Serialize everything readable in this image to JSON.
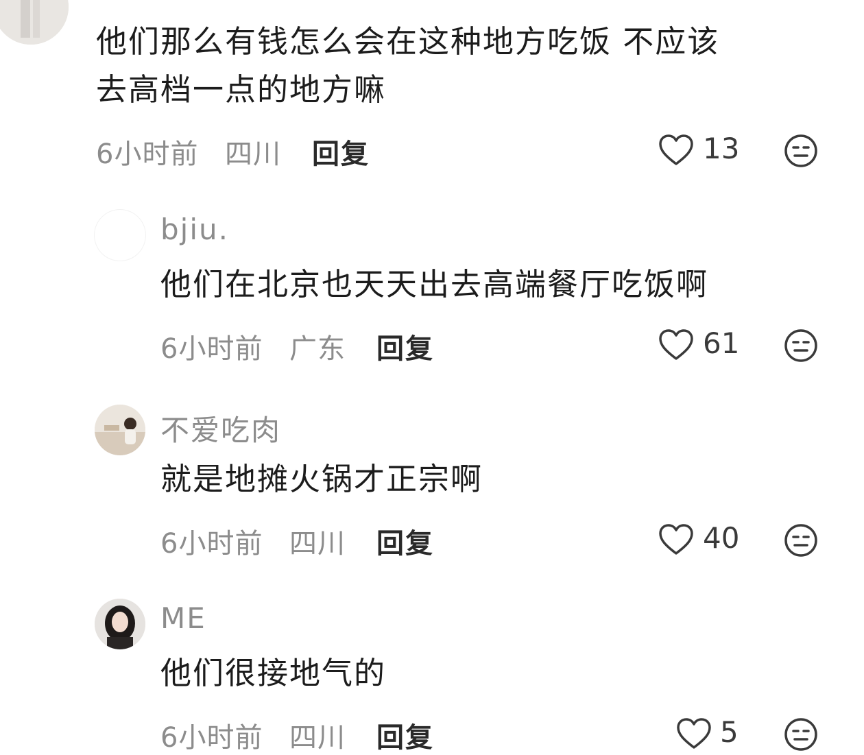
{
  "comments": [
    {
      "text_line1": "他们那么有钱怎么会在这种地方吃饭  不应该",
      "text_line2": "去高档一点的地方嘛",
      "time": "6小时前",
      "location": "四川",
      "reply_label": "回复",
      "likes": "13"
    },
    {
      "username": "bjiu.",
      "text": "他们在北京也天天出去高端餐厅吃饭啊",
      "time": "6小时前",
      "location": "广东",
      "reply_label": "回复",
      "likes": "61"
    },
    {
      "username": "不爱吃肉",
      "text": "就是地摊火锅才正宗啊",
      "time": "6小时前",
      "location": "四川",
      "reply_label": "回复",
      "likes": "40"
    },
    {
      "username": "ME",
      "text": "他们很接地气的",
      "time": "6小时前",
      "location": "四川",
      "reply_label": "回复",
      "likes": "5"
    }
  ],
  "icons": {
    "like": "heart-outline-icon",
    "dislike": "neutral-face-icon"
  },
  "colors": {
    "text": "#1c1c1c",
    "meta": "#8c8c8c",
    "reply": "#2a2a2a"
  }
}
